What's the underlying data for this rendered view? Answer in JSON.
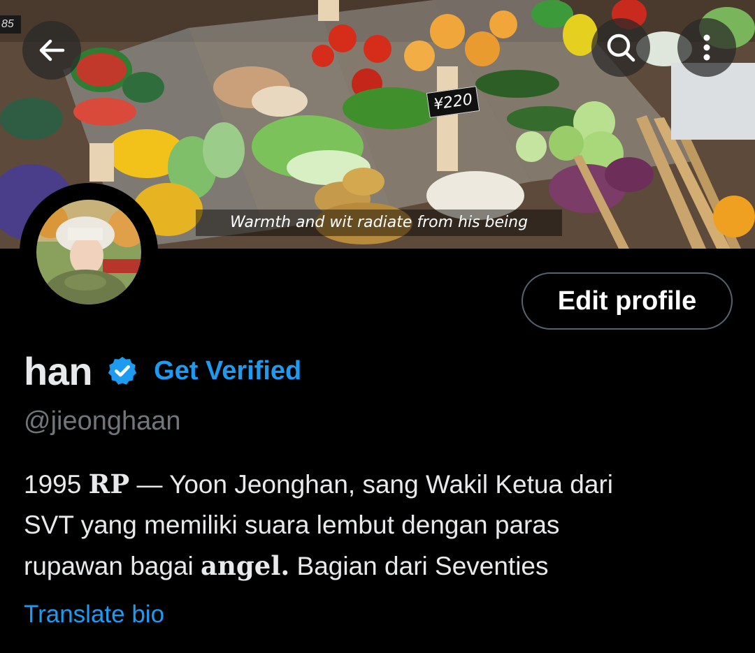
{
  "header": {
    "back_icon": "arrow-left-icon",
    "search_icon": "search-icon",
    "more_icon": "more-vertical-icon"
  },
  "banner": {
    "caption": "Warmth and wit radiate from his being",
    "price_tag": "¥220",
    "corner_tag": "85"
  },
  "profile": {
    "display_name": "han",
    "verified_icon": "verified-badge-icon",
    "get_verified_label": "Get Verified",
    "handle": "@jieonghaan",
    "edit_profile_label": "Edit profile",
    "bio": {
      "line1_prefix": "1995 ",
      "line1_rp": "RP",
      "line1_suffix": " — Yoon Jeonghan, sang Wakil Ketua dari",
      "line2": "SVT yang memiliki suara lembut dengan paras",
      "line3_prefix": "rupawan bagai ",
      "line3_angel": "angel.",
      "line3_suffix": " Bagian dari Seventies"
    },
    "translate_bio_label": "Translate bio"
  },
  "colors": {
    "accent": "#1d9bf0",
    "background": "#000000",
    "text": "#e7e9ea",
    "muted": "#71767b",
    "border": "#536471"
  }
}
